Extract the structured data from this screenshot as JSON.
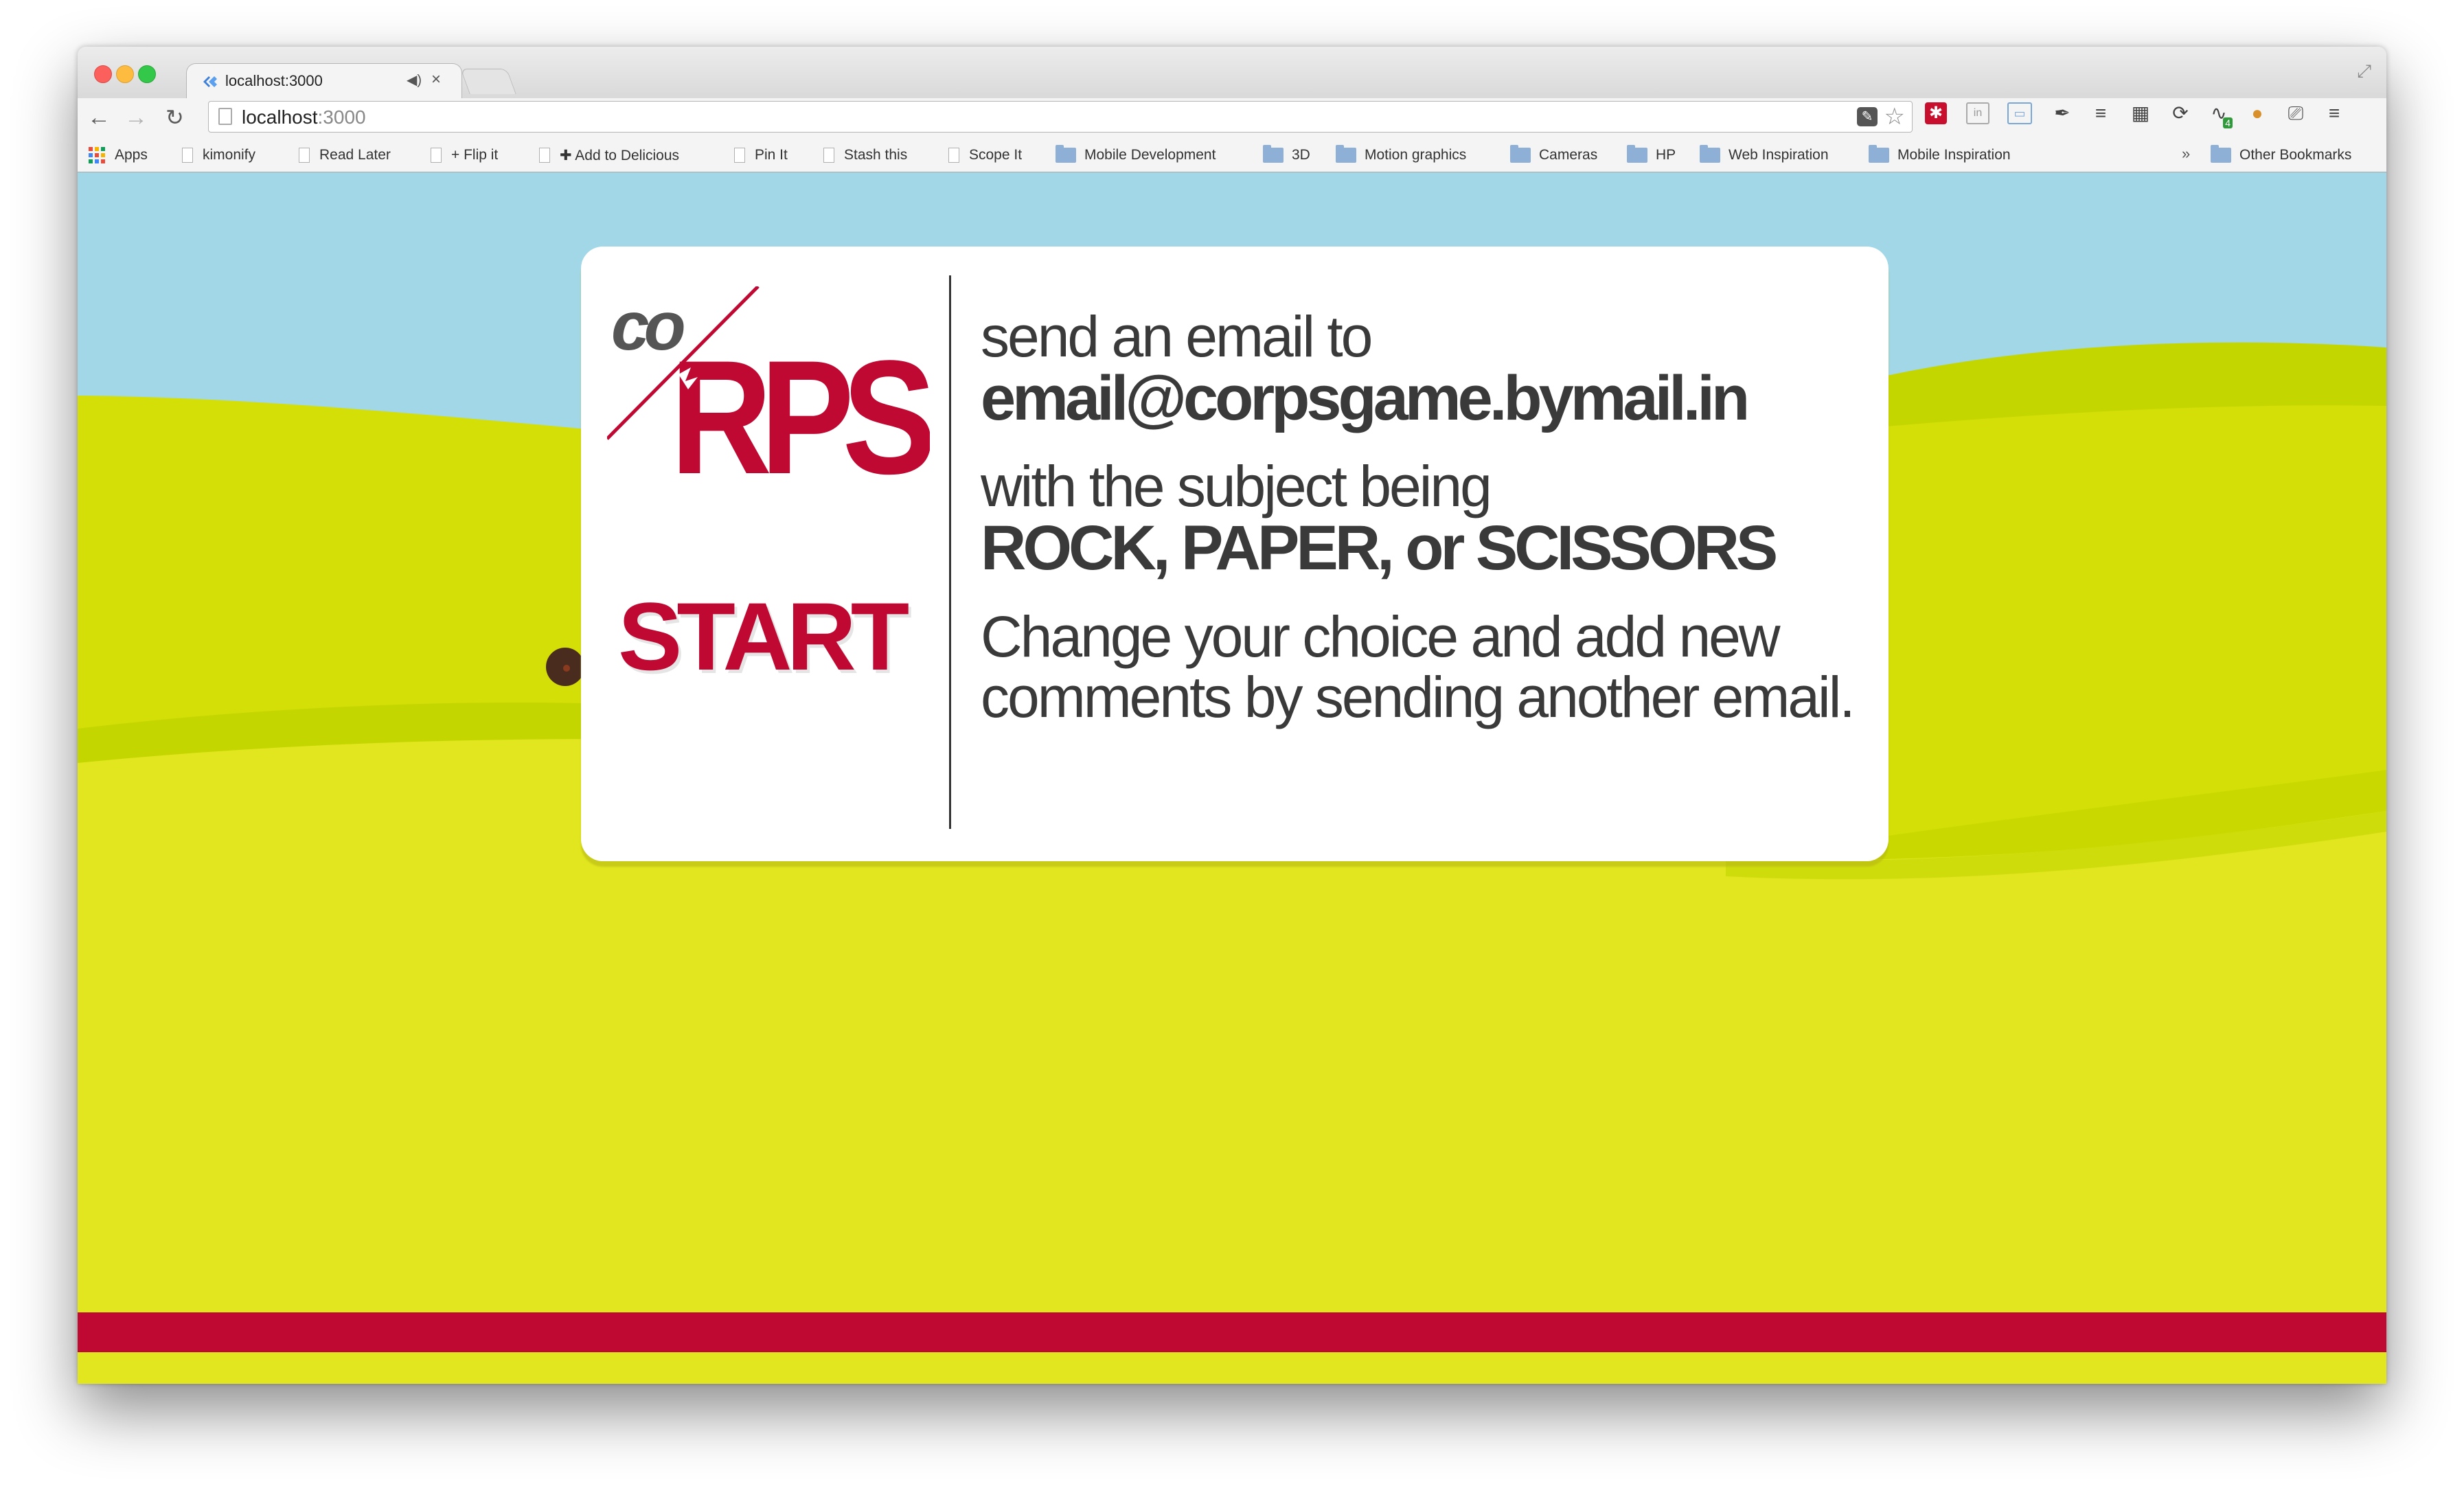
{
  "browser": {
    "tab": {
      "title": "localhost:3000"
    },
    "url": {
      "host": "localhost",
      "port": ":3000"
    },
    "bookmarks": [
      {
        "label": "Apps",
        "type": "apps"
      },
      {
        "label": "kimonify",
        "type": "page"
      },
      {
        "label": "Read Later",
        "type": "page"
      },
      {
        "label": "+ Flip it",
        "type": "page"
      },
      {
        "label": "✚ Add to Delicious",
        "type": "page"
      },
      {
        "label": "Pin It",
        "type": "page"
      },
      {
        "label": "Stash this",
        "type": "page"
      },
      {
        "label": "Scope It",
        "type": "page"
      },
      {
        "label": "Mobile Development",
        "type": "folder"
      },
      {
        "label": "3D",
        "type": "folder"
      },
      {
        "label": "Motion graphics",
        "type": "folder"
      },
      {
        "label": "Cameras",
        "type": "folder"
      },
      {
        "label": "HP",
        "type": "folder"
      },
      {
        "label": "Web Inspiration",
        "type": "folder"
      },
      {
        "label": "Mobile Inspiration",
        "type": "folder"
      }
    ],
    "overflow_chevron": "»",
    "other_bookmarks": "Other Bookmarks",
    "extension_badge": "4"
  },
  "page": {
    "logo": {
      "small": "co",
      "big": "RPS"
    },
    "start_label": "START",
    "instructions": {
      "line1": "send an email to",
      "email": "email@corpsgame.bymail.in",
      "line2": "with the subject being",
      "choices": "ROCK, PAPER, or SCISSORS",
      "line3": "Change your choice and add new comments by sending another email."
    }
  },
  "colors": {
    "sky": "#a2d7e8",
    "hill_light": "#e1e61e",
    "hill_mid": "#d3df06",
    "hill_dark": "#c4d600",
    "brand_red": "#bf0932",
    "text": "#3a3a3a"
  }
}
